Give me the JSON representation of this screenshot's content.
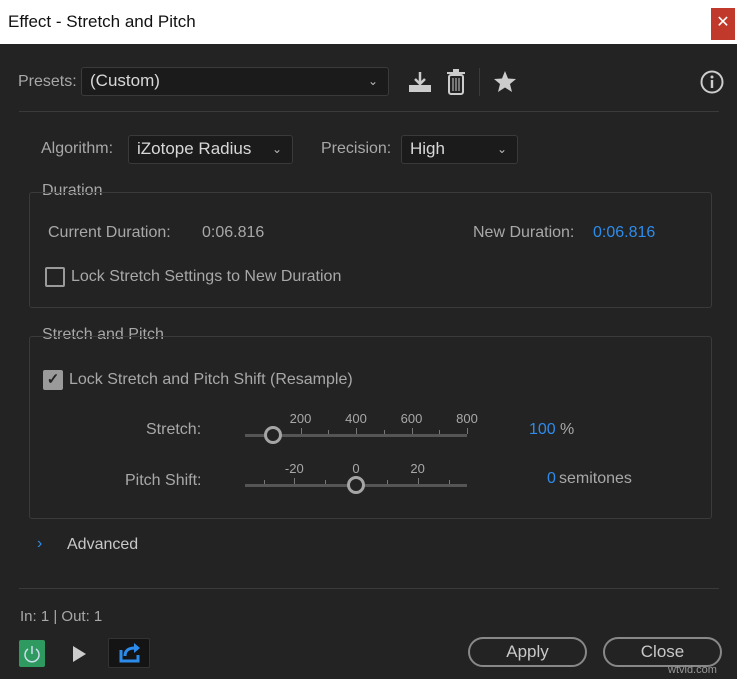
{
  "window": {
    "title": "Effect - Stretch and Pitch",
    "close_icon": "✕"
  },
  "presets": {
    "label": "Presets:",
    "value": "(Custom)"
  },
  "algorithm": {
    "label": "Algorithm:",
    "value": "iZotope Radius"
  },
  "precision": {
    "label": "Precision:",
    "value": "High"
  },
  "duration": {
    "title": "Duration",
    "current_label": "Current Duration:",
    "current_value": "0:06.816",
    "new_label": "New Duration:",
    "new_value": "0:06.816",
    "lock_label": "Lock Stretch Settings to New Duration",
    "lock_checked": false
  },
  "stretch_pitch": {
    "title": "Stretch and Pitch",
    "lock_label": "Lock Stretch and Pitch Shift (Resample)",
    "lock_checked": true,
    "stretch": {
      "label": "Stretch:",
      "value": "100",
      "unit": "%",
      "min": 0,
      "max": 800,
      "current": 100,
      "tick_labels": [
        "200",
        "400",
        "600",
        "800"
      ]
    },
    "pitch": {
      "label": "Pitch Shift:",
      "value": "0",
      "unit": "semitones",
      "min": -36,
      "max": 36,
      "current": 0,
      "tick_labels": [
        "-20",
        "0",
        "20"
      ]
    }
  },
  "advanced": {
    "label": "Advanced"
  },
  "footer": {
    "io": "In: 1 | Out: 1",
    "apply": "Apply",
    "close": "Close"
  },
  "watermark": "wtvid.com",
  "colors": {
    "accent": "#2d8ceb",
    "power": "#2e9a5f"
  }
}
